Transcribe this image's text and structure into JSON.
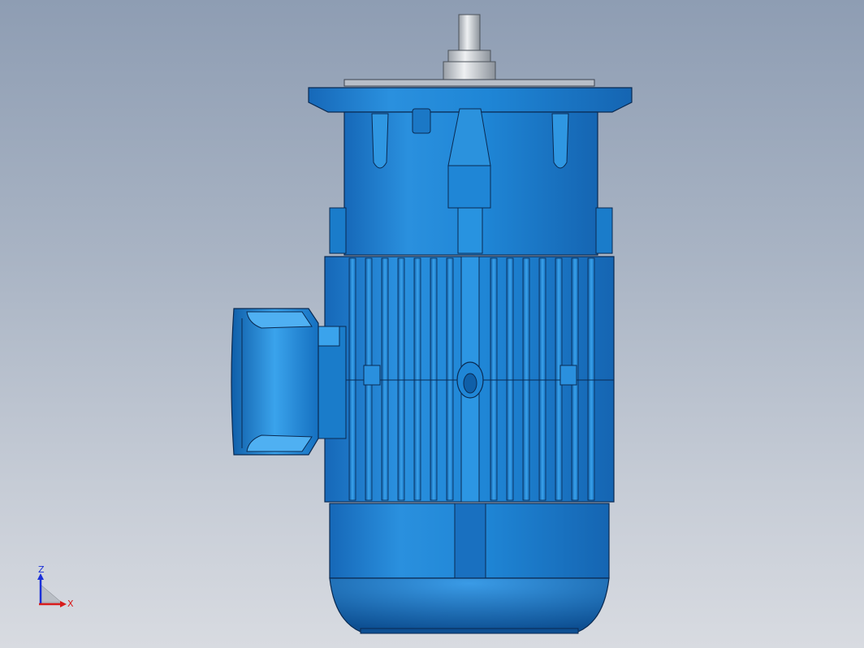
{
  "app": {
    "view": "cad-3d-viewport",
    "model": "vertical-flange-motor"
  },
  "triad": {
    "z_label": "Z",
    "x_label": "X",
    "z_color": "#1a2fd8",
    "x_color": "#d81a1a"
  },
  "colors": {
    "background_top": "#8e9db3",
    "background_bottom": "#d8dbe1",
    "body_main": "#1f86d6",
    "body_dark": "#0f5fa8",
    "body_light": "#49a9ee",
    "edge": "#0a2a52",
    "shaft": "#c9cdd2"
  },
  "icons": {
    "triad": "coordinate-triad-icon"
  }
}
